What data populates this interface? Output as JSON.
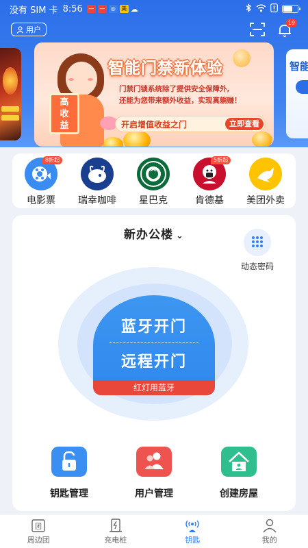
{
  "status_bar": {
    "carrier": "没有 SIM 卡",
    "time": "8:56",
    "meituan_badge": "美",
    "battery_level": 0.7
  },
  "header": {
    "user_label": "用户",
    "notification_count": "19"
  },
  "banner": {
    "title": "智能门禁新体验",
    "desc_line1": "门禁门锁系统除了提供安全保障外,",
    "desc_line2": "还能为您带来额外收益，实现真躺赚！",
    "sign_line1": "高",
    "sign_line2": "收",
    "sign_line3": "益",
    "cta_text": "开启增值收益之门",
    "cta_button": "立即查看",
    "side_right_text": "智能"
  },
  "shortcuts": [
    {
      "label": "电影票",
      "tag": "8折起",
      "color": "#3a8cf0",
      "icon": "film-icon"
    },
    {
      "label": "瑞幸咖啡",
      "tag": "",
      "color": "#1a3f8f",
      "icon": "luckin-deer-icon"
    },
    {
      "label": "星巴克",
      "tag": "",
      "color": "#0b6b3a",
      "icon": "starbucks-icon"
    },
    {
      "label": "肯德基",
      "tag": "5折起",
      "color": "#c8102e",
      "icon": "kfc-icon"
    },
    {
      "label": "美团外卖",
      "tag": "",
      "color": "#ffc300",
      "icon": "kangaroo-icon"
    }
  ],
  "main": {
    "building": "新办公楼",
    "dynamic_password": "动态密码",
    "bluetooth_open": "蓝牙开门",
    "remote_open": "远程开门",
    "hint": "红灯用蓝牙"
  },
  "actions": [
    {
      "label": "钥匙管理",
      "color": "#3b8ef2",
      "icon": "unlock-icon"
    },
    {
      "label": "用户管理",
      "color": "#ef5350",
      "icon": "users-icon"
    },
    {
      "label": "创建房屋",
      "color": "#2fbf8f",
      "icon": "house-icon"
    }
  ],
  "tabs": [
    {
      "label": "周边团",
      "icon": "group-icon"
    },
    {
      "label": "充电桩",
      "icon": "charging-pile-icon"
    },
    {
      "label": "钥匙",
      "icon": "key-signal-icon",
      "active": true
    },
    {
      "label": "我的",
      "icon": "profile-icon"
    }
  ]
}
